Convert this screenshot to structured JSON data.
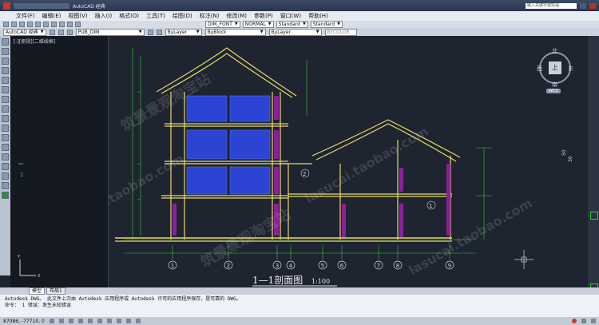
{
  "titlebar": {
    "app_label": "AutoCAD 经典",
    "search_placeholder": "键入关键字或短语"
  },
  "menu": [
    "文件(F)",
    "编辑(E)",
    "视图(V)",
    "插入(I)",
    "格式(O)",
    "工具(T)",
    "绘图(D)",
    "标注(N)",
    "修改(M)",
    "参数(P)",
    "窗口(W)",
    "帮助(H)"
  ],
  "toolbar1": {
    "dim_style": "DIM_FONT",
    "text_style": "NORMAL",
    "dim_style2": "Standard",
    "table_style": "Standard"
  },
  "toolbar2": {
    "workspace": "AutoCAD 经典",
    "layer": "PUB_DIM",
    "color": "ByLayer",
    "linetype": "ByBlock",
    "lineweight": "ByLayer",
    "plotstyle": "BYCOLOR"
  },
  "viewport_label": "[-][俯视][二维线框]",
  "viewcube": {
    "top": "北",
    "left": "西",
    "right": "东",
    "bottom": "南",
    "center": "上",
    "wcs": "WCS"
  },
  "drawing": {
    "title": "1—1剖面图",
    "scale": "1:100",
    "axes": [
      "1",
      "2",
      "3",
      "4",
      "5",
      "6",
      "7",
      "8",
      "9"
    ],
    "markers": [
      "2",
      "1"
    ],
    "right_dims": [
      "50",
      "30"
    ]
  },
  "watermarks": [
    "筑景景观淘宝站",
    "lasucai.taobao.com",
    "tacai.taobao.com",
    "筑景景观淘宝站",
    "lasucai.taobao.com"
  ],
  "tabs": [
    "模型",
    "布局1"
  ],
  "command_lines": [
    "Autodesk DWG。 此文件上次由 Autodesk 应用程序或 Autodesk 许可的应用程序保存，是可靠的 DWG。",
    "命令： 1 错误：发生未知错误"
  ],
  "status": {
    "coords": "87086, -77710, 0"
  },
  "colors": {
    "structure": "#e8d96a",
    "glass": "#2b44d4",
    "column": "#8b1f9e",
    "grid": "#2fd03a"
  }
}
